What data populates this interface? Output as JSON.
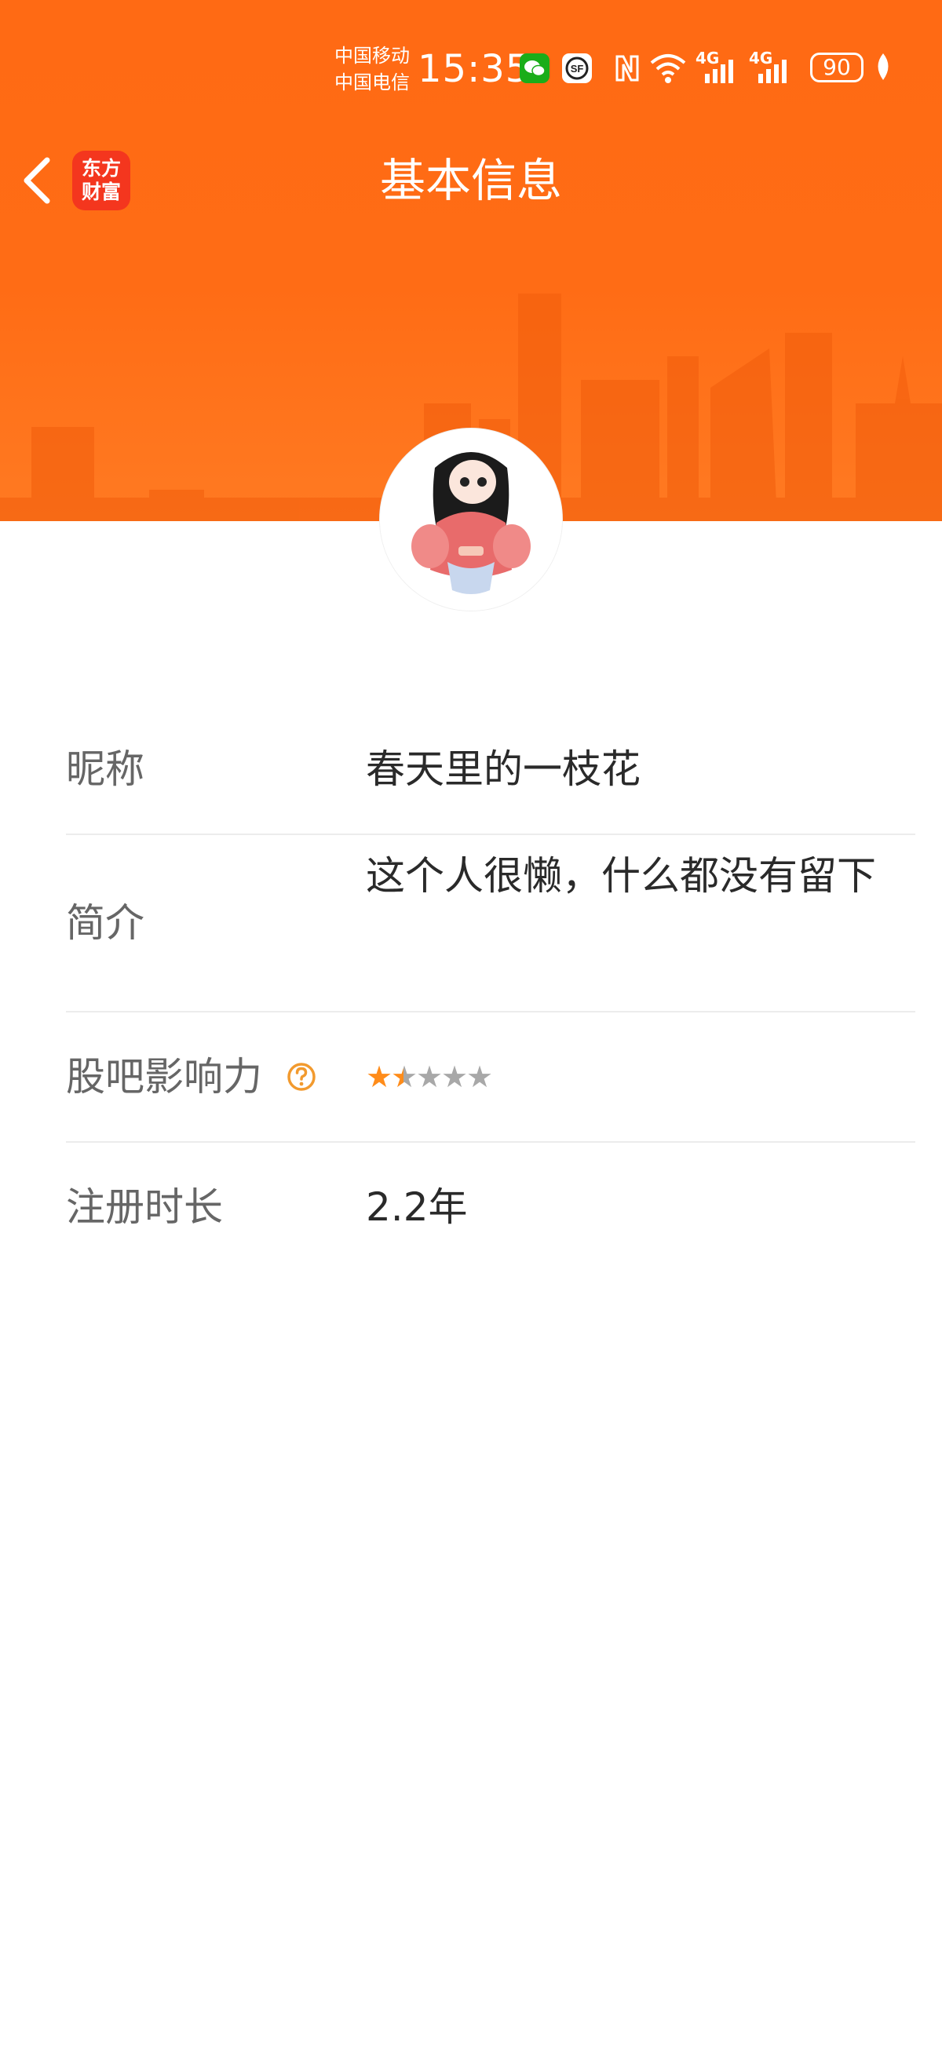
{
  "status_bar": {
    "carrier_1": "中国移动",
    "carrier_2": "中国电信",
    "time": "15:35",
    "network_1": "4G",
    "network_2": "4G",
    "battery": "90",
    "icons": [
      "wechat-icon",
      "sf-express-icon",
      "nfc-icon",
      "wifi-icon",
      "signal-icon",
      "battery-icon",
      "leaf-icon"
    ]
  },
  "header": {
    "title": "基本信息",
    "logo_line_1": "东方",
    "logo_line_2": "财富",
    "back_icon": "chevron-left-icon"
  },
  "profile": {
    "rows": [
      {
        "label": "昵称",
        "value": "春天里的一枝花"
      },
      {
        "label": "简介",
        "value": "这个人很懒，什么都没有留下"
      },
      {
        "label": "股吧影响力",
        "rating": 1.5,
        "rating_max": 5
      },
      {
        "label": "注册时长",
        "value": "2.2年"
      }
    ]
  },
  "colors": {
    "header_orange": "#ff6a14",
    "logo_red": "#f4361e",
    "star_filled": "#ff8c1a",
    "star_empty": "#a8a8a8",
    "help_icon": "#f29a2e"
  }
}
